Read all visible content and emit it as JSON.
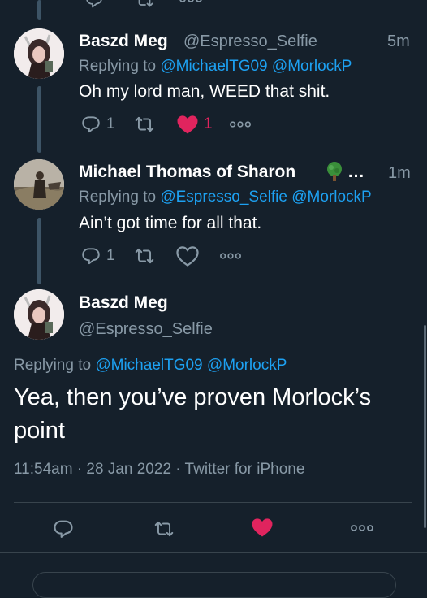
{
  "tweets": [
    {
      "name": "Baszd Meg",
      "handle": "@Espresso_Selfie",
      "time": "5m",
      "replying_prefix": "Replying to",
      "replying_to": [
        "@MichaelTG09",
        "@MorlockP"
      ],
      "text": "Oh my lord man, WEED that shit.",
      "reply_count": "1",
      "retweet_count": "",
      "like_count": "1",
      "liked": true
    },
    {
      "name": "Michael Thomas of Sharon",
      "name_suffix": "…",
      "handle": "",
      "time": "1m",
      "replying_prefix": "Replying to",
      "replying_to": [
        "@Espresso_Selfie",
        "@MorlockP"
      ],
      "text": "Ain’t got time for all that.",
      "reply_count": "1",
      "retweet_count": "",
      "like_count": "",
      "liked": false
    }
  ],
  "main": {
    "name": "Baszd Meg",
    "handle": "@Espresso_Selfie",
    "replying_prefix": "Replying to",
    "replying_to": [
      "@MichaelTG09",
      "@MorlockP"
    ],
    "text_line1": "Yea, then you’ve proven Morlock’s",
    "text_line2": "point",
    "meta": "11:54am · 28 Jan 2022 · Twitter for iPhone",
    "liked": true
  },
  "colors": {
    "background": "#15202b",
    "link": "#1da1f2",
    "muted": "#8899a6",
    "like": "#e0245e"
  },
  "icons": [
    "reply-icon",
    "retweet-icon",
    "like-icon",
    "more-icon",
    "tree-emoji-icon"
  ]
}
